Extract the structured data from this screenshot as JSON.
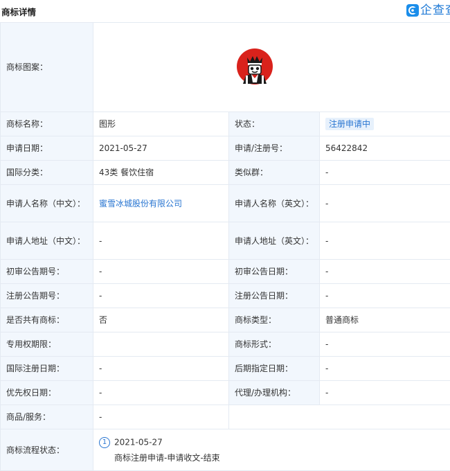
{
  "header": {
    "title": "商标详情",
    "brand": "企查查"
  },
  "trademark_image_label": "商标图案：",
  "rows": [
    {
      "l1": "商标名称：",
      "v1": "图形",
      "l2": "状态：",
      "v2": "注册申请中"
    },
    {
      "l1": "申请日期：",
      "v1": "2021-05-27",
      "l2": "申请/注册号：",
      "v2": "56422842"
    },
    {
      "l1": "国际分类：",
      "v1": "43类 餐饮住宿",
      "l2": "类似群：",
      "v2": "-"
    },
    {
      "l1": "申请人名称（中文）：",
      "v1": "蜜雪冰城股份有限公司",
      "l2": "申请人名称（英文）：",
      "v2": "-"
    },
    {
      "l1": "申请人地址（中文）：",
      "v1": "-",
      "l2": "申请人地址（英文）：",
      "v2": "-"
    },
    {
      "l1": "初审公告期号：",
      "v1": "-",
      "l2": "初审公告日期：",
      "v2": "-"
    },
    {
      "l1": "注册公告期号：",
      "v1": "-",
      "l2": "注册公告日期：",
      "v2": "-"
    },
    {
      "l1": "是否共有商标：",
      "v1": "否",
      "l2": "商标类型：",
      "v2": "普通商标"
    },
    {
      "l1": "专用权期限：",
      "v1": "",
      "l2": "商标形式：",
      "v2": "-"
    },
    {
      "l1": "国际注册日期：",
      "v1": "-",
      "l2": "后期指定日期：",
      "v2": "-"
    },
    {
      "l1": "优先权日期：",
      "v1": "-",
      "l2": "代理/办理机构：",
      "v2": "-"
    }
  ],
  "goods": {
    "label": "商品/服务：",
    "value": "-"
  },
  "flow": {
    "label": "商标流程状态：",
    "step_number": "1",
    "date": "2021-05-27",
    "description": "商标注册申请-申请收文-结束"
  },
  "colors": {
    "label_bg": "#f2f7fd",
    "border": "#e4eaf2",
    "link": "#2875d1",
    "brand": "#1a8dea",
    "mark_red": "#d9221c"
  },
  "icons": {
    "brand": "qcc-logo-icon",
    "mark": "trademark-king-figure-icon"
  }
}
